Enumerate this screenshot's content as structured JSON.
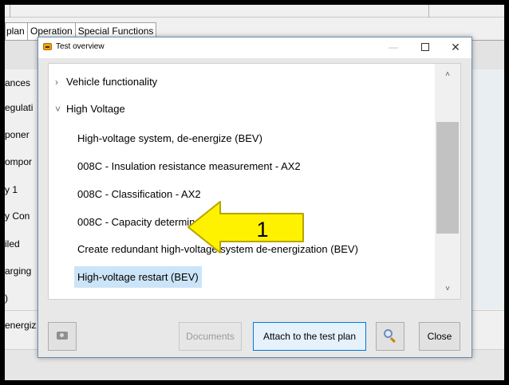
{
  "background": {
    "tabs": [
      "plan",
      "Operation",
      "Special Functions"
    ],
    "left_items": [
      "ances",
      "egulati",
      "poner",
      "ompor",
      "y 1",
      "y Con",
      "iled",
      "arging",
      ")"
    ],
    "energize_label": "energiz"
  },
  "dialog": {
    "title": "Test overview",
    "window_buttons": {
      "minimize": "—",
      "close": "✕"
    },
    "tree": {
      "items": [
        {
          "label": "Vehicle functionality",
          "glyph": "›"
        },
        {
          "label": "High Voltage",
          "glyph": "˅"
        },
        {
          "label": "High-voltage system, de-energize (BEV)"
        },
        {
          "label": "008C  - Insulation resistance measurement - AX2"
        },
        {
          "label": "008C  - Classification - AX2"
        },
        {
          "label": "008C  - Capacity determination - AX2"
        },
        {
          "label": "Create redundant high-voltage system de-energization (BEV)"
        },
        {
          "label": "High-voltage restart (BEV)"
        }
      ],
      "scroll_up": "˄",
      "scroll_down": "˅"
    },
    "callout_number": "1",
    "buttons": {
      "documents": "Documents",
      "attach": "Attach to the test plan",
      "close": "Close"
    },
    "colors": {
      "selection": "#cce4f7",
      "callout_fill": "#fff200",
      "callout_stroke": "#b8a400",
      "focus_border": "#0078d7"
    },
    "icons": {
      "app": "warning-icon",
      "camera": "camera-icon",
      "search": "magnifier-icon"
    }
  }
}
